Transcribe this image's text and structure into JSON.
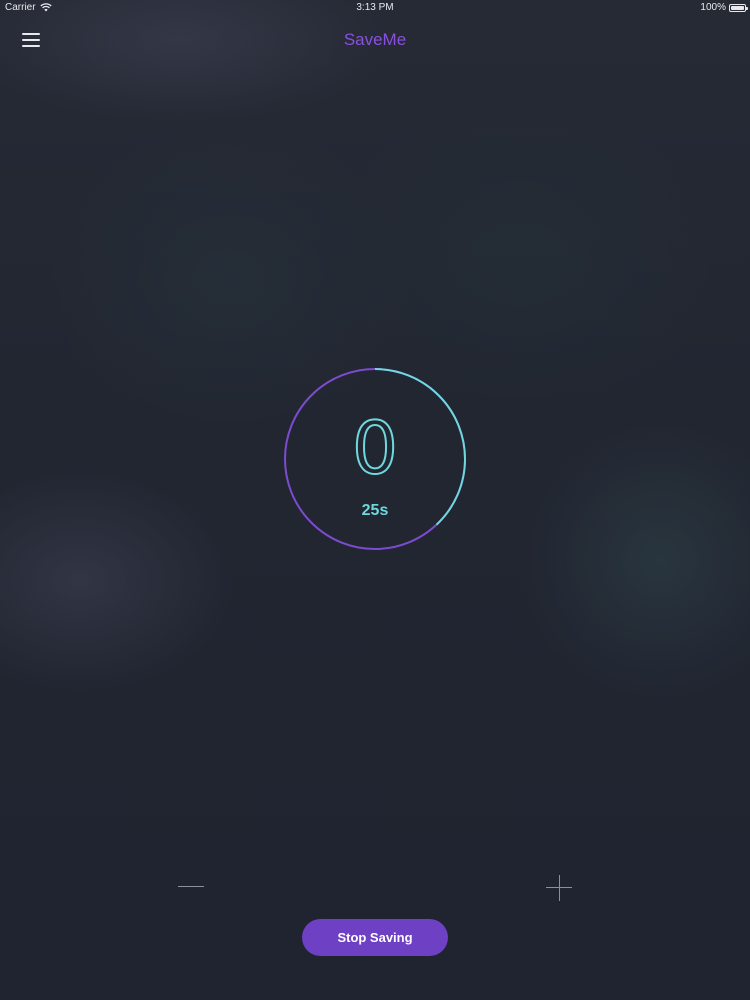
{
  "status_bar": {
    "carrier": "Carrier",
    "time": "3:13 PM",
    "battery": "100%"
  },
  "nav": {
    "title": "SaveMe",
    "menu_icon": "hamburger-menu-icon"
  },
  "timer": {
    "count": "0",
    "seconds": "25s",
    "progress": 0.38,
    "progress_color": "#6fd8dd",
    "track_color": "#7c4bd0"
  },
  "controls": {
    "decrease_icon": "minus-icon",
    "increase_icon": "plus-icon",
    "stop_label": "Stop Saving"
  },
  "colors": {
    "accent": "#8a4fe0",
    "button": "#6e40c4",
    "teal": "#6fd8dd",
    "background": "#222631"
  }
}
